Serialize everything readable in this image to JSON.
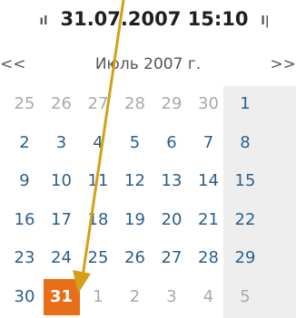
{
  "header": {
    "datetime": "31.07.2007 15:10",
    "left_icon": "left-marker-icon",
    "right_icon": "right-marker-icon"
  },
  "nav": {
    "prev_label": "<<",
    "month_title": "Июль 2007 г.",
    "next_label": ">>"
  },
  "selected_day": "31",
  "weeks": [
    [
      "25",
      "26",
      "27",
      "28",
      "29",
      "30",
      "1"
    ],
    [
      "2",
      "3",
      "4",
      "5",
      "6",
      "7",
      "8"
    ],
    [
      "9",
      "10",
      "11",
      "12",
      "13",
      "14",
      "15"
    ],
    [
      "16",
      "17",
      "18",
      "19",
      "20",
      "21",
      "22"
    ],
    [
      "23",
      "24",
      "25",
      "26",
      "27",
      "28",
      "29"
    ],
    [
      "30",
      "31",
      "1",
      "2",
      "3",
      "4",
      "5"
    ]
  ],
  "current_month_flags": [
    [
      false,
      false,
      false,
      false,
      false,
      false,
      true
    ],
    [
      true,
      true,
      true,
      true,
      true,
      true,
      true
    ],
    [
      true,
      true,
      true,
      true,
      true,
      true,
      true
    ],
    [
      true,
      true,
      true,
      true,
      true,
      true,
      true
    ],
    [
      true,
      true,
      true,
      true,
      true,
      true,
      true
    ],
    [
      true,
      true,
      false,
      false,
      false,
      false,
      false
    ]
  ],
  "colors": {
    "accent": "#e86e1a",
    "day_text": "#2d5f8a",
    "other_month_text": "#a9a9a9",
    "weekend_band": "#eeeeee",
    "annotation_arrow": "#d4a017"
  }
}
